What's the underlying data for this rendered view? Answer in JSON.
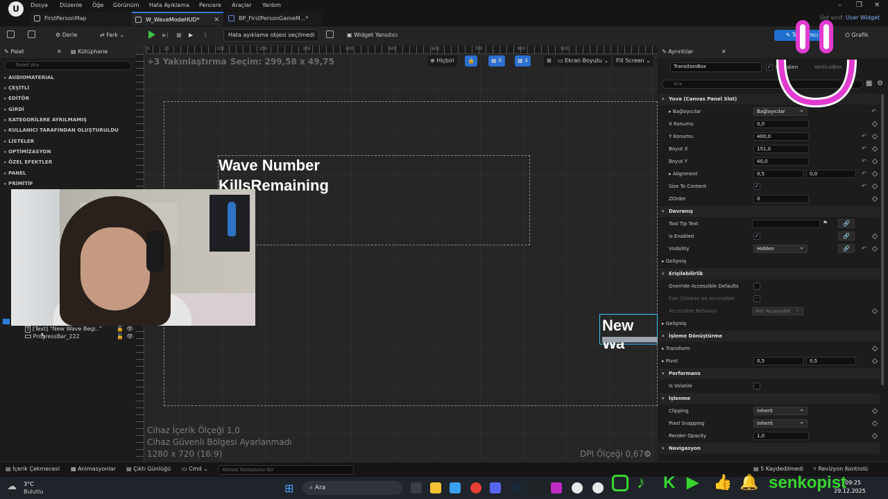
{
  "menu": {
    "items": [
      "Dosya",
      "Düzenle",
      "Öğe",
      "Görünüm",
      "Hata Ayıklama",
      "Pencere",
      "Araçlar",
      "Yardım"
    ],
    "parent_class_label": "Üst sınıf:",
    "parent_class_value": "User Widget"
  },
  "tabs": [
    {
      "label": "FirstPersonMap",
      "active": false
    },
    {
      "label": "W_WaveModeHUD*",
      "active": true
    },
    {
      "label": "BP_FirstPersonGameM...*",
      "active": false
    }
  ],
  "toolbar": {
    "compile_label": "Derle",
    "diff_label": "Fark",
    "debug_select": "Hata ayıklama objesi seçilmedi",
    "widget_reflector": "Widget Yansıtıcı",
    "designer_label": "Tasarımcı",
    "graph_label": "Grafik"
  },
  "left": {
    "palette_tab": "Palet",
    "library_tab": "Kütüphane",
    "search_placeholder": "Paleti Ara",
    "categories": [
      "AUDIOMATERIAL",
      "ÇEŞİTLİ",
      "EDİTÖR",
      "GİRDİ",
      "KATEGORİLERE AYRILMAMIŞ",
      "KULLANICI TARAFINDAN OLUŞTURULDU",
      "LİSTELER",
      "OPTİMİZASYON",
      "ÖZEL EFEKTLER",
      "PANEL",
      "PRİMİTİF"
    ],
    "hierarchy": [
      {
        "label": "[Text] \"New Wave Begi..\"",
        "icon": "text-widget-icon"
      },
      {
        "label": "ProgressBar_222",
        "icon": "progress-bar-icon"
      }
    ]
  },
  "canvas": {
    "zoom_label": "+3 Yakınlaştırma",
    "selection_label": "Seçim: 299,58 x 49,75",
    "wave_number": "Wave Number",
    "kills_remaining": "KillsRemaining",
    "new_wave": "New Wa",
    "none_label": "Hiçbiri",
    "r_label": "R",
    "grid_value": "4",
    "screen_size": "Ekran Boyutu",
    "fill_screen": "Fill Screen",
    "content_scale": "Cihaz İçerik Ölçeği 1,0",
    "safe_zone": "Cihaz Güvenli Bölgesi Ayarlanmadı",
    "resolution": "1280 x 720 (16:9)",
    "dpi_scale": "DPI Ölçeği 0,67",
    "ruler_marks": [
      "0",
      "10",
      "100",
      "200",
      "300",
      "400",
      "500",
      "600",
      "700",
      "800",
      "900"
    ]
  },
  "details": {
    "tab": "Ayrıntılar",
    "name_value": "TransitionBox",
    "is_variable": "Değişken",
    "vertical_box": "VerticalBox",
    "search_placeholder": "Ara",
    "sections": {
      "slot": "Yuva (Canvas Panel Slot)",
      "behavior": "Davranış",
      "advanced": "Gelişmiş",
      "accessibility": "Erişilebilirlik",
      "advanced2": "Gelişmiş",
      "render_transform": "İşleme Dönüştürme",
      "performance": "Performans",
      "rendering": "İşlenme",
      "navigation": "Navigasyon"
    },
    "rows": {
      "anchors_label": "Bağlayıcılar",
      "anchors_value": "Bağlayıcılar",
      "x_pos_label": "X Konumu",
      "x_pos": "0,0",
      "y_pos_label": "Y Konumu",
      "y_pos": "400,0",
      "size_x_label": "Boyut X",
      "size_x": "151,0",
      "size_y_label": "Boyut Y",
      "size_y": "40,0",
      "alignment_label": "Alignment",
      "alignment_x": "0,5",
      "alignment_y": "0,0",
      "size_to_content": "Size To Content",
      "zorder_label": "ZOrder",
      "zorder": "0",
      "tooltip_label": "Tool Tip Text",
      "is_enabled": "Is Enabled",
      "visibility_label": "Visibility",
      "visibility": "Hidden",
      "override_accessible": "Override Accessible Defaults",
      "children_accessible": "Can Children be Accessible",
      "accessible_behavior": "Accessible Behavior",
      "not_accessible": "Not Accessible",
      "transform": "Transform",
      "pivot_label": "Pivot",
      "pivot_x": "0,5",
      "pivot_y": "0,5",
      "is_volatile": "Is Volatile",
      "clipping_label": "Clipping",
      "clipping": "Inherit",
      "pixel_snapping_label": "Pixel Snapping",
      "pixel_snapping": "Inherit",
      "render_opacity_label": "Render Opacity",
      "render_opacity": "1,0"
    }
  },
  "bottom": {
    "content_drawer": "İçerik Çekmecesi",
    "animations": "Animasyonlar",
    "output_log": "Çıktı Günlüğü",
    "cmd": "Cmd",
    "console_placeholder": "Konsol Komutunu Gir",
    "saved": "5 Kaydedilmedi",
    "revision": "Revizyon Kontrolü"
  },
  "taskbar": {
    "weather_temp": "3°C",
    "weather_desc": "Bulutlu",
    "search": "Ara",
    "time": "09:25",
    "date": "29.12.2025",
    "brand": "senkopist"
  },
  "colors": {
    "accent": "#2f7ee0",
    "overlay_pink": "#e23bd0",
    "social_green": "#37d62e"
  }
}
